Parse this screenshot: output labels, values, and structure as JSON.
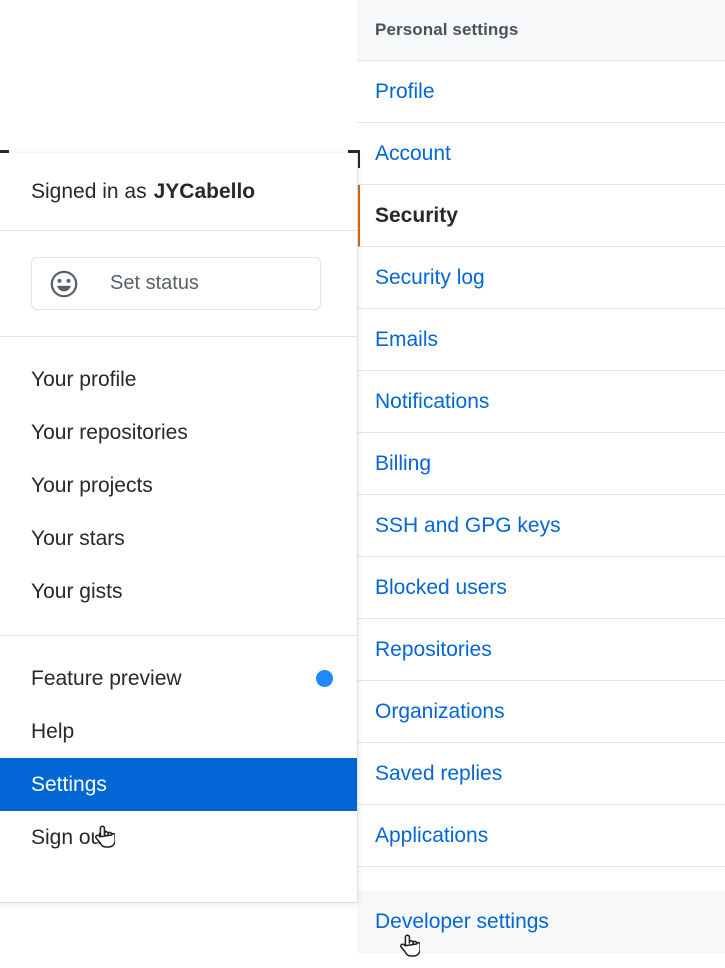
{
  "settings_nav": {
    "header": "Personal settings",
    "items": [
      {
        "label": "Profile",
        "state": "link"
      },
      {
        "label": "Account",
        "state": "link"
      },
      {
        "label": "Security",
        "state": "selected"
      },
      {
        "label": "Security log",
        "state": "link"
      },
      {
        "label": "Emails",
        "state": "link"
      },
      {
        "label": "Notifications",
        "state": "link"
      },
      {
        "label": "Billing",
        "state": "link"
      },
      {
        "label": "SSH and GPG keys",
        "state": "link"
      },
      {
        "label": "Blocked users",
        "state": "link"
      },
      {
        "label": "Repositories",
        "state": "link"
      },
      {
        "label": "Organizations",
        "state": "link"
      },
      {
        "label": "Saved replies",
        "state": "link"
      },
      {
        "label": "Applications",
        "state": "link"
      }
    ],
    "footer_item": {
      "label": "Developer settings",
      "state": "hovered"
    },
    "accent_selected": "#e36209",
    "link_color": "#0366d6",
    "header_bg": "#f6f8fa",
    "hover_bg": "#f6f8fa",
    "border_color": "#e1e4e8"
  },
  "user_dropdown": {
    "signed_in_prefix": "Signed in as",
    "username": "JYCabello",
    "status_button": {
      "icon": "smiley-icon",
      "label": "Set status"
    },
    "group_one": [
      {
        "label": "Your profile"
      },
      {
        "label": "Your repositories"
      },
      {
        "label": "Your projects"
      },
      {
        "label": "Your stars"
      },
      {
        "label": "Your gists"
      }
    ],
    "group_two": [
      {
        "label": "Feature preview",
        "badge": "blue-dot",
        "badge_color": "#2188ff"
      },
      {
        "label": "Help"
      },
      {
        "label": "Settings",
        "state": "active",
        "active_bg": "#0366d6"
      },
      {
        "label": "Sign out"
      }
    ]
  },
  "cursors": [
    {
      "name": "pointer-cursor-on-settings"
    },
    {
      "name": "pointer-cursor-on-developer-settings"
    }
  ]
}
